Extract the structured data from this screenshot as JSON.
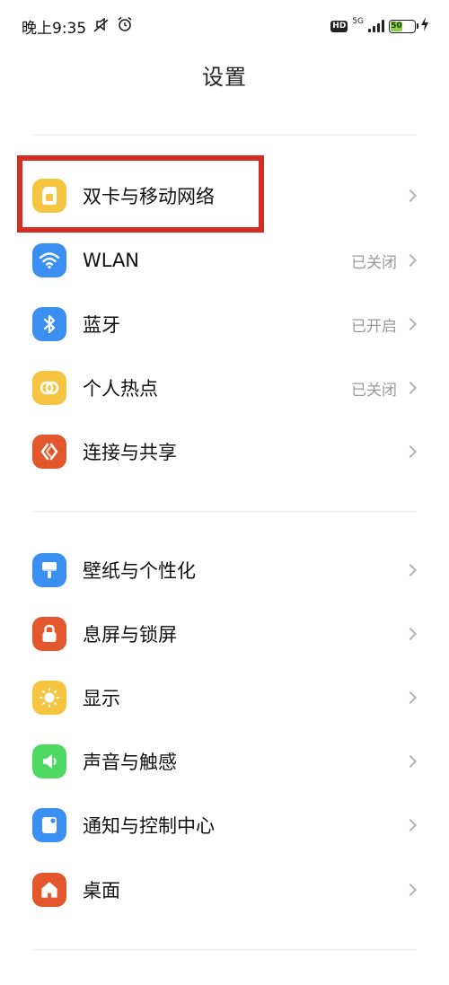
{
  "status_bar": {
    "time": "晚上9:35",
    "hd": "HD",
    "network": "5G",
    "battery": "50",
    "battery_level": 0.5
  },
  "page": {
    "title": "设置"
  },
  "groups": [
    {
      "items": [
        {
          "label": "双卡与移动网络",
          "value": "",
          "icon": "sim-card-icon",
          "color": "#f5c542"
        },
        {
          "label": "WLAN",
          "value": "已关闭",
          "icon": "wifi-icon",
          "color": "#3b8ff0"
        },
        {
          "label": "蓝牙",
          "value": "已开启",
          "icon": "bluetooth-icon",
          "color": "#3b8ff0"
        },
        {
          "label": "个人热点",
          "value": "已关闭",
          "icon": "hotspot-icon",
          "color": "#f5c542"
        },
        {
          "label": "连接与共享",
          "value": "",
          "icon": "connection-share-icon",
          "color": "#e2572b"
        }
      ]
    },
    {
      "items": [
        {
          "label": "壁纸与个性化",
          "value": "",
          "icon": "wallpaper-brush-icon",
          "color": "#3b8ff0"
        },
        {
          "label": "息屏与锁屏",
          "value": "",
          "icon": "lock-icon",
          "color": "#e2572b"
        },
        {
          "label": "显示",
          "value": "",
          "icon": "brightness-icon",
          "color": "#f5c542"
        },
        {
          "label": "声音与触感",
          "value": "",
          "icon": "speaker-icon",
          "color": "#4cd964"
        },
        {
          "label": "通知与控制中心",
          "value": "",
          "icon": "notification-icon",
          "color": "#3b8ff0"
        },
        {
          "label": "桌面",
          "value": "",
          "icon": "home-icon",
          "color": "#e2572b"
        }
      ]
    }
  ],
  "colors": {
    "highlight": "#d42d22",
    "chevron": "#b4b4b4",
    "value_text": "#9a9a9a"
  }
}
